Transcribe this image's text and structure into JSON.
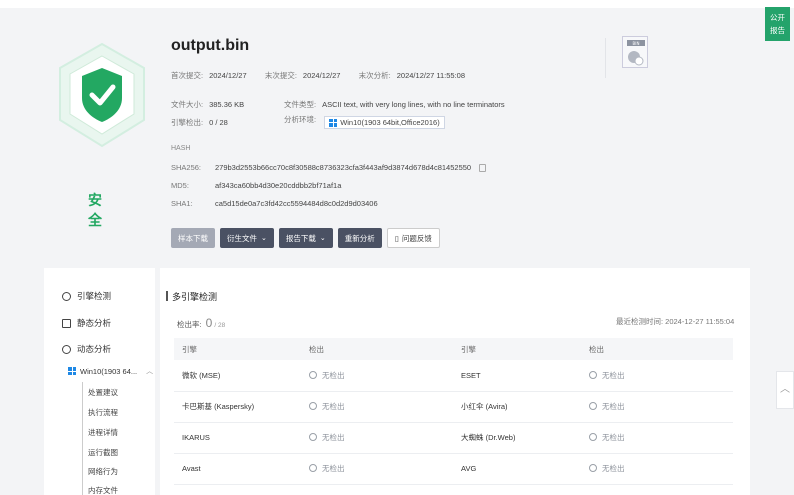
{
  "report_button": "公开\n报告",
  "verdict": "安全",
  "file": {
    "name": "output.bin",
    "first_submit_label": "首次提交:",
    "first_submit": "2024/12/27",
    "last_submit_label": "末次提交:",
    "last_submit": "2024/12/27",
    "last_analysis_label": "末次分析:",
    "last_analysis": "2024/12/27 11:55:08",
    "size_label": "文件大小:",
    "size": "385.36 KB",
    "type_label": "文件类型:",
    "type": "ASCII text, with very long lines, with no line terminators",
    "engine_label": "引擎检出:",
    "engine": "0 / 28",
    "env_label": "分析环境:",
    "env": "Win10(1903 64bit,Office2016)"
  },
  "hash": {
    "title": "HASH",
    "sha256_label": "SHA256:",
    "sha256": "279b3d2553b66cc70c8f30588c8736323cfa3f443af9d3874d678d4c81452550",
    "md5_label": "MD5:",
    "md5": "af343ca60bb4d30e20cddbb2bf71af1a",
    "sha1_label": "SHA1:",
    "sha1": "ca5d15de0a7c3fd42cc5594484d8c0d2d9d03406"
  },
  "buttons": {
    "sample_download": "样本下载",
    "derived_files": "衍生文件",
    "report_download": "报告下载",
    "reanalyze": "重新分析",
    "feedback": "问题反馈"
  },
  "sidebar": {
    "items": [
      "引擎检测",
      "静态分析",
      "动态分析"
    ],
    "env": "Win10(1903 64...",
    "sub_items": [
      "处置建议",
      "执行流程",
      "进程详情",
      "运行截图",
      "网络行为",
      "内存文件"
    ]
  },
  "main": {
    "title": "多引擎检测",
    "rate_label": "检出率:",
    "rate_value": "0",
    "rate_total": "/ 28",
    "last_time": "最近检测时间: 2024-12-27 11:55:04",
    "columns": [
      "引擎",
      "检出",
      "引擎",
      "检出"
    ],
    "rows": [
      [
        "微软 (MSE)",
        "无检出",
        "ESET",
        "无检出"
      ],
      [
        "卡巴斯基 (Kaspersky)",
        "无检出",
        "小红伞 (Avira)",
        "无检出"
      ],
      [
        "IKARUS",
        "无检出",
        "大蜘蛛 (Dr.Web)",
        "无检出"
      ],
      [
        "Avast",
        "无检出",
        "AVG",
        "无检出"
      ]
    ]
  },
  "colors": {
    "safe": "#23a862",
    "accent_dark": "#4a5163",
    "windows_blue": "#1e88e5"
  }
}
